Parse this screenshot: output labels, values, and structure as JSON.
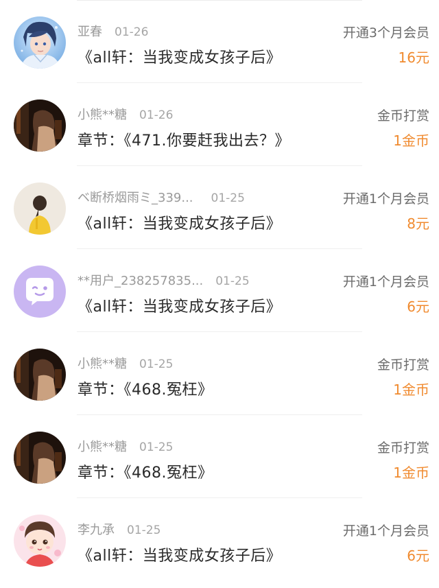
{
  "records": [
    {
      "user": "亚春",
      "date": "01-26",
      "title": "《all轩：当我变成女孩子后》",
      "type": "开通3个月会员",
      "amount": "16元",
      "avatar": "anime-boy-blue-avatar"
    },
    {
      "user": "小熊**糖",
      "date": "01-26",
      "title": "章节：《471.你要赶我出去？》",
      "type": "金币打赏",
      "amount": "1金币",
      "avatar": "dark-photo-avatar"
    },
    {
      "user": "ベ断桥烟雨ミ_339...",
      "date": "01-25",
      "title": "《all轩：当我变成女孩子后》",
      "type": "开通1个月会员",
      "amount": "8元",
      "avatar": "girl-back-yellow-avatar"
    },
    {
      "user": "**用户_238257835...",
      "date": "01-25",
      "title": "《all轩：当我变成女孩子后》",
      "type": "开通1个月会员",
      "amount": "6元",
      "avatar": "purple-chat-bubble-avatar"
    },
    {
      "user": "小熊**糖",
      "date": "01-25",
      "title": "章节：《468.冤枉》",
      "type": "金币打赏",
      "amount": "1金币",
      "avatar": "dark-photo-avatar"
    },
    {
      "user": "小熊**糖",
      "date": "01-25",
      "title": "章节：《468.冤枉》",
      "type": "金币打赏",
      "amount": "1金币",
      "avatar": "dark-photo-avatar"
    },
    {
      "user": "李九承",
      "date": "01-25",
      "title": "《all轩：当我变成女孩子后》",
      "type": "开通1个月会员",
      "amount": "6元",
      "avatar": "cartoon-kid-avatar"
    }
  ],
  "colors": {
    "amount": "#f08a2e",
    "meta": "#9a9a9a",
    "title": "#2a2a2a",
    "type": "#6b6b6b"
  }
}
